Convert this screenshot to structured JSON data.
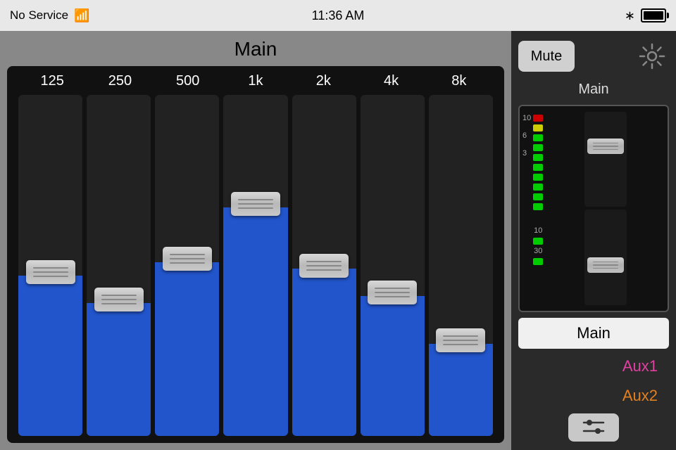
{
  "status_bar": {
    "no_service": "No Service",
    "time": "11:36 AM"
  },
  "eq": {
    "title": "Main",
    "frequencies": [
      "125",
      "250",
      "500",
      "1k",
      "2k",
      "4k",
      "8k"
    ],
    "slider_positions": [
      0.52,
      0.6,
      0.48,
      0.32,
      0.5,
      0.58,
      0.72
    ],
    "fill_heights": [
      0.47,
      0.39,
      0.51,
      0.67,
      0.49,
      0.41,
      0.27
    ]
  },
  "right_panel": {
    "mute_label": "Mute",
    "channel_label": "Main",
    "main_button": "Main",
    "aux1_label": "Aux1",
    "aux2_label": "Aux2",
    "vu_labels_top": [
      "10",
      "6",
      "3"
    ],
    "vu_labels_bottom": [
      "10",
      "30"
    ]
  }
}
